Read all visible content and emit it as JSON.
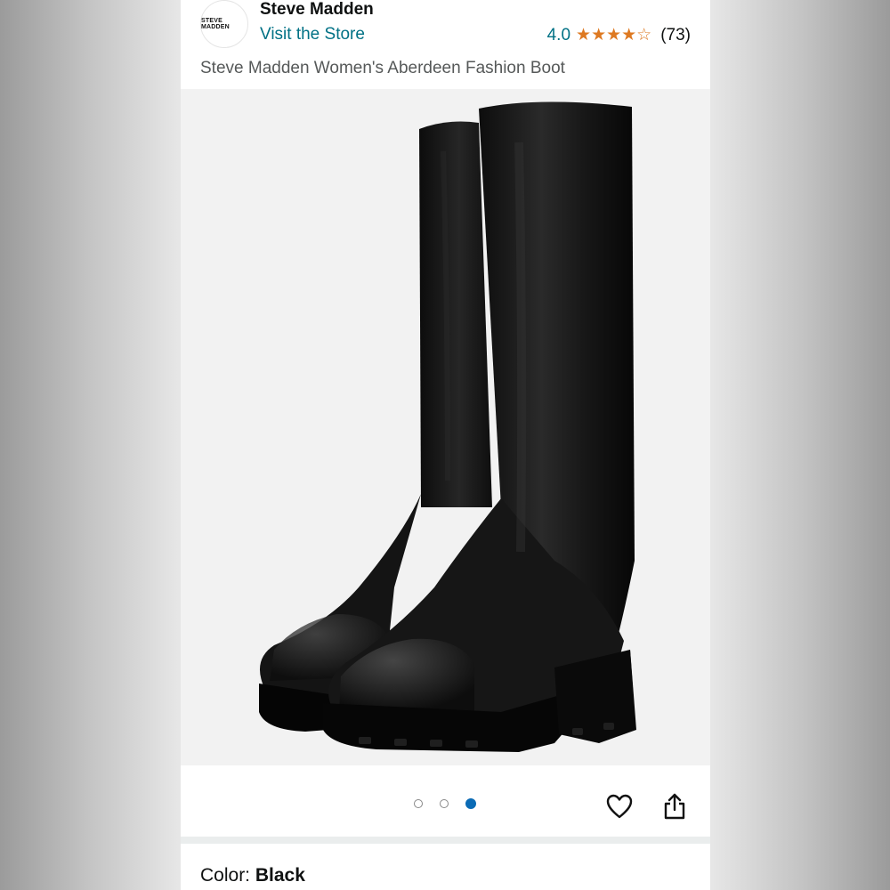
{
  "header": {
    "brand_logo_text": "STEVE MADDEN",
    "brand_name": "Steve Madden",
    "store_link": "Visit the Store",
    "rating_value": "4.0",
    "stars": "★★★★☆",
    "review_count": "(73)"
  },
  "product": {
    "title": "Steve Madden Women's Aberdeen Fashion Boot"
  },
  "gallery": {
    "image_count": 3,
    "active_index": 2,
    "image_alt": "black knee-high boots"
  },
  "actions": {
    "favorite_icon": "heart-icon",
    "share_icon": "share-icon"
  },
  "variant": {
    "color_label": "Color: ",
    "color_value": "Black"
  },
  "colors": {
    "link": "#007185",
    "star": "#de7921",
    "active_dot": "#0b6bb5"
  }
}
